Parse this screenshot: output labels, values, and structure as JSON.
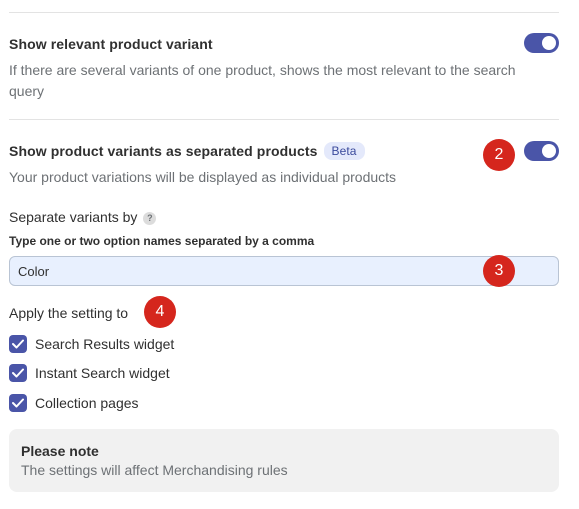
{
  "settings": {
    "relevant_variant": {
      "title": "Show relevant product variant",
      "description": "If there are several variants of one product, shows the most relevant to the search query",
      "enabled": true
    },
    "separated_variants": {
      "title": "Show product variants as separated products",
      "badge": "Beta",
      "description": "Your product variations will be displayed as individual products",
      "enabled": true
    },
    "separate_by": {
      "label": "Separate variants by",
      "help_icon": "?",
      "hint": "Type one or two option names separated by a comma",
      "value": "Color"
    },
    "apply_to": {
      "label": "Apply the setting to",
      "options": [
        {
          "label": "Search Results widget",
          "checked": true
        },
        {
          "label": "Instant Search widget",
          "checked": true
        },
        {
          "label": "Collection pages",
          "checked": true
        }
      ]
    },
    "note": {
      "title": "Please note",
      "text": "The settings will affect Merchandising rules"
    }
  },
  "step_markers": [
    "2",
    "3",
    "4"
  ],
  "colors": {
    "accent": "#4a55a8",
    "step_marker": "#d5261d",
    "badge_bg": "#e4e9fb",
    "input_bg": "#e8f0fe"
  }
}
